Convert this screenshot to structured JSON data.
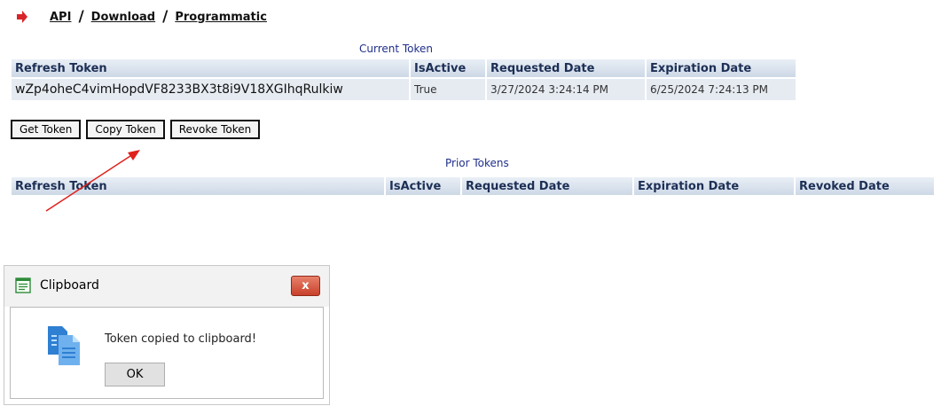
{
  "breadcrumb": {
    "items": [
      "API",
      "Download",
      "Programmatic"
    ],
    "separator": "/"
  },
  "current_token": {
    "caption": "Current Token",
    "columns": [
      "Refresh Token",
      "IsActive",
      "Requested Date",
      "Expiration Date"
    ],
    "row": {
      "refresh_token": "wZp4oheC4vimHopdVF8233BX3t8i9V18XGIhqRulkiw",
      "is_active": "True",
      "requested_date": "3/27/2024 3:24:14 PM",
      "expiration_date": "6/25/2024 7:24:13 PM"
    }
  },
  "buttons": {
    "get_token": "Get Token",
    "copy_token": "Copy Token",
    "revoke_token": "Revoke Token"
  },
  "prior_tokens": {
    "caption": "Prior Tokens",
    "columns": [
      "Refresh Token",
      "IsActive",
      "Requested Date",
      "Expiration Date",
      "Revoked Date"
    ]
  },
  "dialog": {
    "title": "Clipboard",
    "close_label": "x",
    "message": "Token copied to clipboard!",
    "ok_label": "OK",
    "title_icon": "clipboard-icon",
    "message_icon": "copy-documents-icon"
  },
  "colors": {
    "caption": "#1f2f8a",
    "header_text": "#1d2f55",
    "arrow": "#e0201b",
    "close_button": "#c8402a"
  }
}
